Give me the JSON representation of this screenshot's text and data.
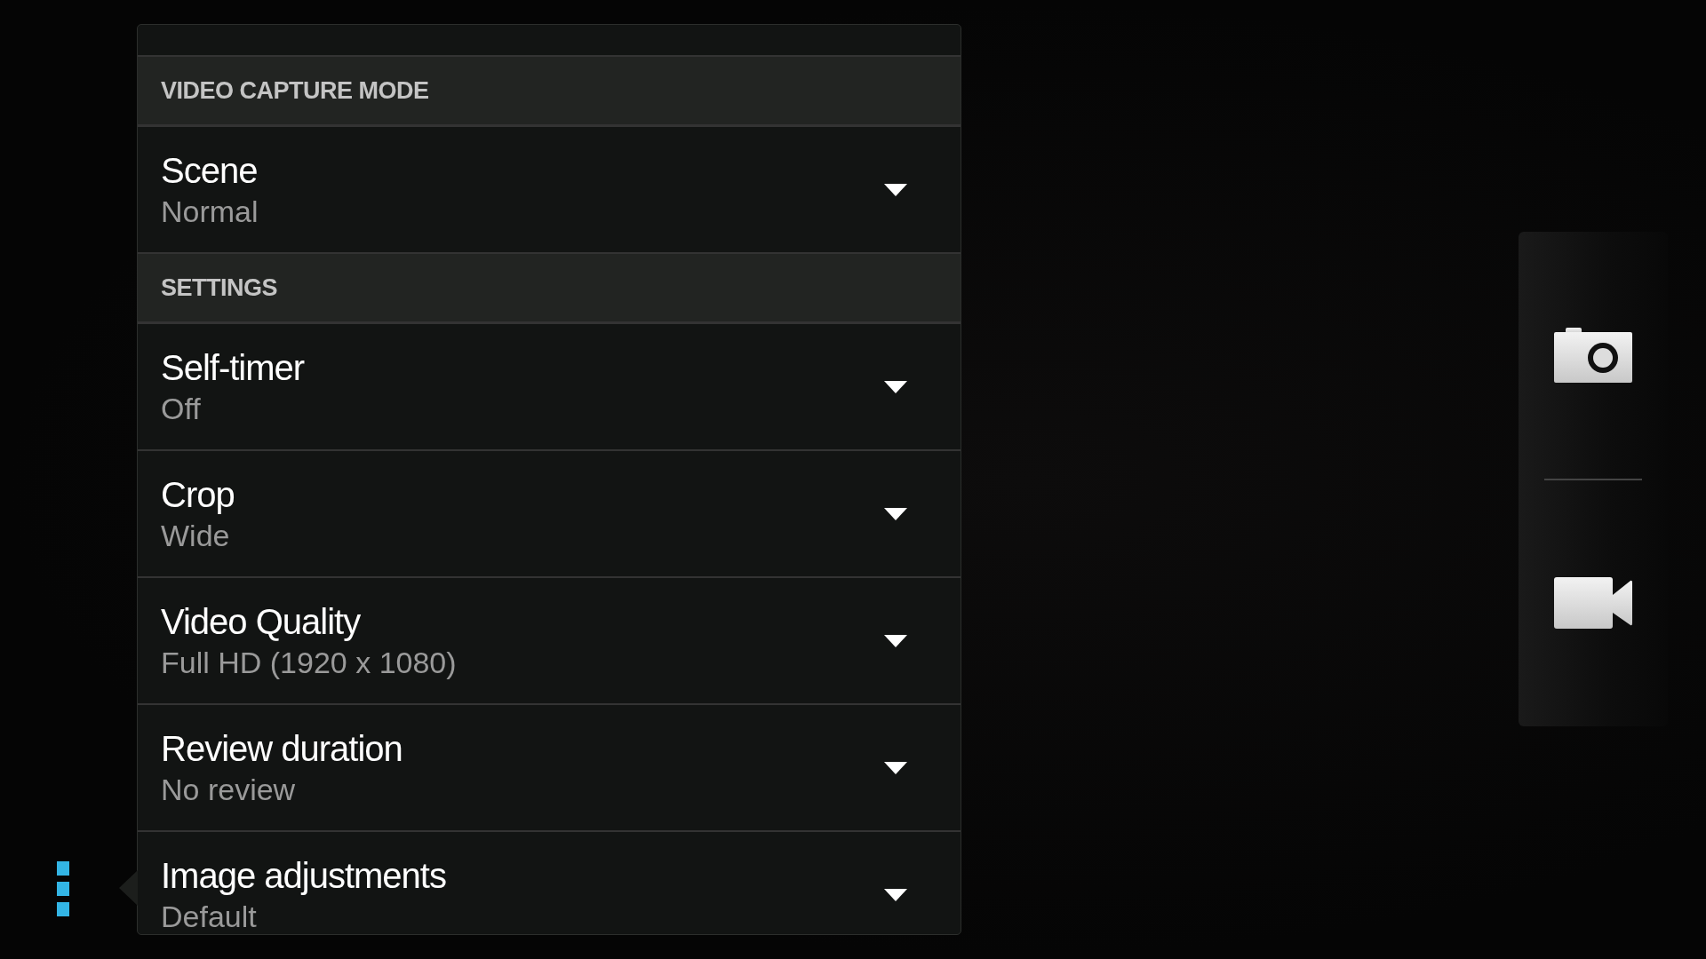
{
  "settings_panel": {
    "sections": [
      {
        "header": "VIDEO CAPTURE MODE",
        "items": [
          {
            "title": "Scene",
            "value": "Normal"
          }
        ]
      },
      {
        "header": "SETTINGS",
        "items": [
          {
            "title": "Self-timer",
            "value": "Off"
          },
          {
            "title": "Crop",
            "value": "Wide"
          },
          {
            "title": "Video Quality",
            "value": "Full HD (1920 x 1080)"
          },
          {
            "title": "Review duration",
            "value": "No review"
          },
          {
            "title": "Image adjustments",
            "value": "Default"
          }
        ]
      }
    ]
  },
  "mode_switcher": {
    "modes": [
      {
        "kind": "photo"
      },
      {
        "kind": "video"
      }
    ]
  }
}
